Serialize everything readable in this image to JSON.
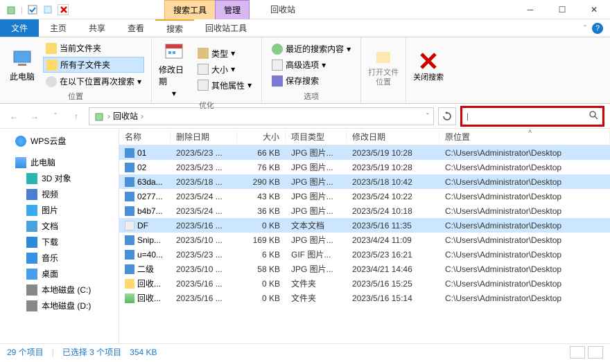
{
  "title": "回收站",
  "context_tabs": {
    "search": "搜索工具",
    "manage": "管理"
  },
  "menu": {
    "file": "文件",
    "home": "主页",
    "share": "共享",
    "view": "查看",
    "search": "搜索",
    "recycle_tools": "回收站工具"
  },
  "ribbon": {
    "loc_group": "位置",
    "this_pc": "此电脑",
    "current_folder": "当前文件夹",
    "all_subfolders": "所有子文件夹",
    "search_again": "在以下位置再次搜索",
    "optimize_group": "优化",
    "modify_date": "修改日期",
    "type": "类型",
    "size": "大小",
    "other_props": "其他属性",
    "options_group": "选项",
    "recent_search": "最近的搜索内容",
    "advanced": "高级选项",
    "save_search": "保存搜索",
    "open_loc": "打开文件位置",
    "close_search": "关闭搜索"
  },
  "breadcrumb": {
    "location": "回收站"
  },
  "columns": {
    "name": "名称",
    "deleted": "删除日期",
    "size": "大小",
    "type": "项目类型",
    "modified": "修改日期",
    "orig": "原位置"
  },
  "sidebar": [
    {
      "label": "WPS云盘",
      "icon": "ic-cloud"
    },
    {
      "label": "此电脑",
      "icon": "ic-pc",
      "bold": true
    },
    {
      "label": "3D 对象",
      "icon": "ic-3d",
      "indent": true
    },
    {
      "label": "视频",
      "icon": "ic-video",
      "indent": true
    },
    {
      "label": "图片",
      "icon": "ic-pic",
      "indent": true
    },
    {
      "label": "文档",
      "icon": "ic-doc",
      "indent": true
    },
    {
      "label": "下载",
      "icon": "ic-dl",
      "indent": true
    },
    {
      "label": "音乐",
      "icon": "ic-music",
      "indent": true
    },
    {
      "label": "桌面",
      "icon": "ic-desk",
      "indent": true
    },
    {
      "label": "本地磁盘 (C:)",
      "icon": "ic-disk",
      "indent": true
    },
    {
      "label": "本地磁盘 (D:)",
      "icon": "ic-disk",
      "indent": true
    }
  ],
  "rows": [
    {
      "name": "01",
      "del": "2023/5/23 ...",
      "size": "66 KB",
      "type": "JPG 图片...",
      "mod": "2023/5/19 10:28",
      "orig": "C:\\Users\\Administrator\\Desktop",
      "icon": "ic-jpg",
      "sel": true
    },
    {
      "name": "02",
      "del": "2023/5/23 ...",
      "size": "76 KB",
      "type": "JPG 图片...",
      "mod": "2023/5/19 10:28",
      "orig": "C:\\Users\\Administrator\\Desktop",
      "icon": "ic-jpg"
    },
    {
      "name": "63da...",
      "del": "2023/5/18 ...",
      "size": "290 KB",
      "type": "JPG 图片...",
      "mod": "2023/5/18 10:42",
      "orig": "C:\\Users\\Administrator\\Desktop",
      "icon": "ic-jpg",
      "sel": true
    },
    {
      "name": "0277...",
      "del": "2023/5/24 ...",
      "size": "43 KB",
      "type": "JPG 图片...",
      "mod": "2023/5/24 10:22",
      "orig": "C:\\Users\\Administrator\\Desktop",
      "icon": "ic-jpg"
    },
    {
      "name": "b4b7...",
      "del": "2023/5/24 ...",
      "size": "36 KB",
      "type": "JPG 图片...",
      "mod": "2023/5/24 10:18",
      "orig": "C:\\Users\\Administrator\\Desktop",
      "icon": "ic-jpg"
    },
    {
      "name": "DF",
      "del": "2023/5/16 ...",
      "size": "0 KB",
      "type": "文本文档",
      "mod": "2023/5/16 11:35",
      "orig": "C:\\Users\\Administrator\\Desktop",
      "icon": "ic-txt",
      "sel": true
    },
    {
      "name": "Snip...",
      "del": "2023/5/10 ...",
      "size": "169 KB",
      "type": "JPG 图片...",
      "mod": "2023/4/24 11:09",
      "orig": "C:\\Users\\Administrator\\Desktop",
      "icon": "ic-jpg"
    },
    {
      "name": "u=40...",
      "del": "2023/5/23 ...",
      "size": "6 KB",
      "type": "GIF 图片...",
      "mod": "2023/5/23 16:21",
      "orig": "C:\\Users\\Administrator\\Desktop",
      "icon": "ic-gif"
    },
    {
      "name": "二级",
      "del": "2023/5/10 ...",
      "size": "58 KB",
      "type": "JPG 图片...",
      "mod": "2023/4/21 14:46",
      "orig": "C:\\Users\\Administrator\\Desktop",
      "icon": "ic-jpg"
    },
    {
      "name": "回收...",
      "del": "2023/5/16 ...",
      "size": "0 KB",
      "type": "文件夹",
      "mod": "2023/5/16 15:25",
      "orig": "C:\\Users\\Administrator\\Desktop",
      "icon": "ic-fld"
    },
    {
      "name": "回收...",
      "del": "2023/5/16 ...",
      "size": "0 KB",
      "type": "文件夹",
      "mod": "2023/5/16 15:14",
      "orig": "C:\\Users\\Administrator\\Desktop",
      "icon": "ic-recycle"
    }
  ],
  "status": {
    "count": "29 个项目",
    "selected": "已选择 3 个项目",
    "size": "354 KB"
  }
}
